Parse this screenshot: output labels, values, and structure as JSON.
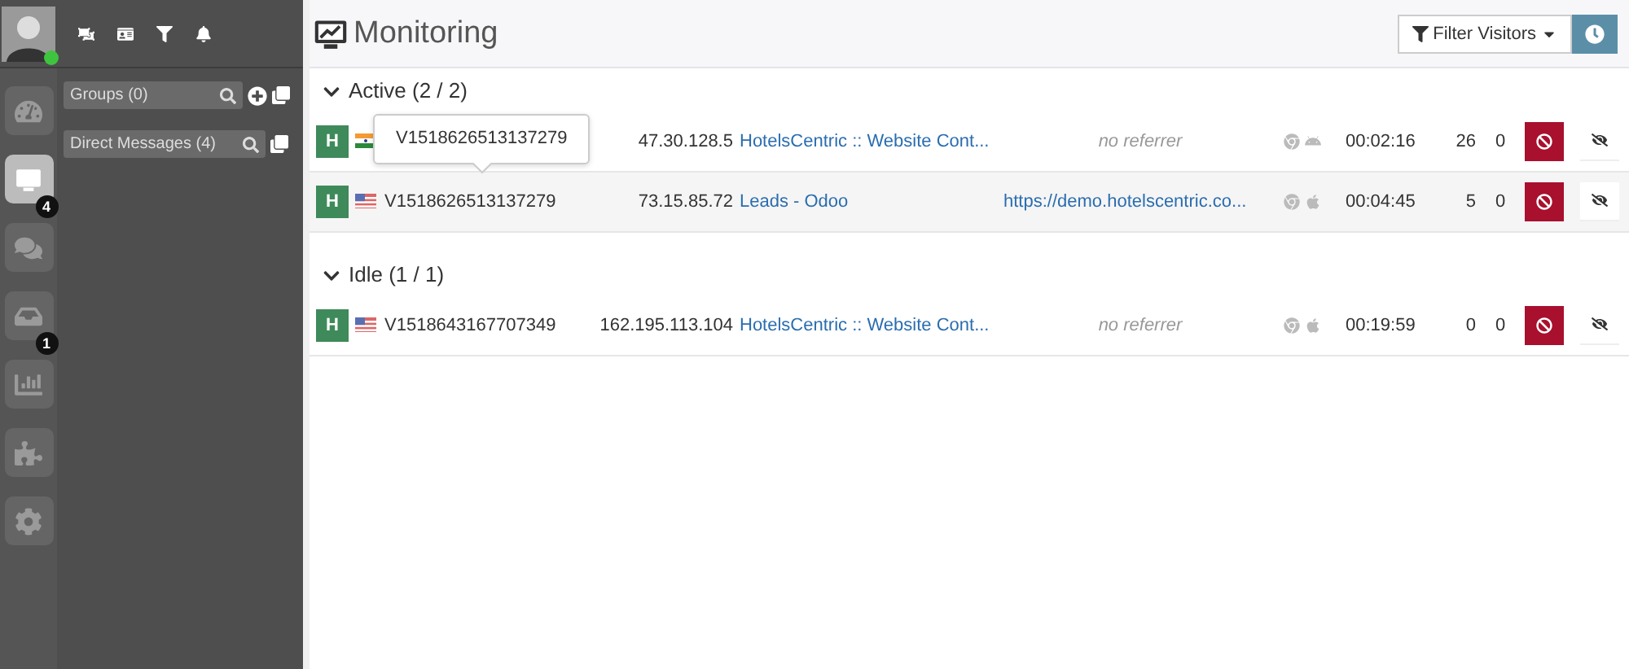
{
  "top_icons": [
    {
      "kind": "ungroup"
    },
    {
      "kind": "card"
    },
    {
      "kind": "filter"
    },
    {
      "kind": "bell"
    }
  ],
  "nav": [
    {
      "kind": "dashboard",
      "selected": false
    },
    {
      "kind": "monitoring",
      "selected": true,
      "badge": "4"
    },
    {
      "kind": "chat",
      "selected": false
    },
    {
      "kind": "inbox",
      "selected": false,
      "badge": "1"
    },
    {
      "kind": "reports",
      "selected": false
    },
    {
      "kind": "plugins",
      "selected": false
    },
    {
      "kind": "settings",
      "selected": false
    }
  ],
  "panels": [
    {
      "placeholder": "Groups (0)",
      "add": true
    },
    {
      "placeholder": "Direct Messages (4)",
      "add": false
    }
  ],
  "header": {
    "title": "Monitoring",
    "filter_button": "Filter Visitors"
  },
  "groups": [
    {
      "label": "Active (2 / 2)",
      "expanded": true,
      "rows": [
        {
          "badge": "H",
          "flag": {
            "kind": "india"
          },
          "tooltip": "V1518626513137279",
          "ip": "47.30.128.5",
          "page": "HotelsCentric :: Website Cont...",
          "referrer": {
            "kind": "none",
            "text": "no referrer"
          },
          "os": {
            "kind": "android"
          },
          "time": "00:02:16",
          "views": "26",
          "chats": "0",
          "highlighted": false
        },
        {
          "badge": "H",
          "flag": {
            "kind": "usa"
          },
          "visitor": "V1518626513137279",
          "ip": "73.15.85.72",
          "page": "Leads - Odoo",
          "referrer": {
            "kind": "link",
            "text": "https://demo.hotelscentric.co..."
          },
          "os": {
            "kind": "apple"
          },
          "time": "00:04:45",
          "views": "5",
          "chats": "0",
          "highlighted": true
        }
      ]
    },
    {
      "label": "Idle (1 / 1)",
      "expanded": true,
      "rows": [
        {
          "badge": "H",
          "flag": {
            "kind": "usa"
          },
          "visitor": "V1518643167707349",
          "ip": "162.195.113.104",
          "page": "HotelsCentric :: Website Cont...",
          "referrer": {
            "kind": "none",
            "text": "no referrer"
          },
          "os": {
            "kind": "apple"
          },
          "time": "00:19:59",
          "views": "0",
          "chats": "0",
          "highlighted": false
        }
      ]
    }
  ]
}
